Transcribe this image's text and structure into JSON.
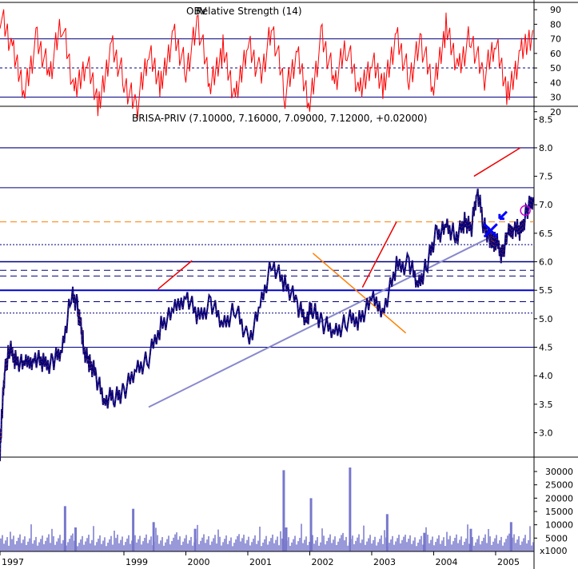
{
  "chart_data": [
    {
      "type": "line",
      "title": "Relative Strength (14)",
      "overlay_title": "OBV",
      "yticks": [
        20,
        30,
        40,
        50,
        60,
        70,
        80,
        90
      ],
      "ylim": [
        10,
        95
      ],
      "reference_lines": {
        "upper": 70,
        "middle": 50,
        "lower": 30
      },
      "series": [
        {
          "color": "#ff0000",
          "x": [
            1997.0,
            1997.2,
            1997.4,
            1997.6,
            1997.8,
            1998.0,
            1998.2,
            1998.4,
            1998.6,
            1998.8,
            1999.0,
            1999.2,
            1999.4,
            1999.6,
            1999.8,
            2000.0,
            2000.2,
            2000.4,
            2000.6,
            2000.8,
            2001.0,
            2001.2,
            2001.4,
            2001.6,
            2001.8,
            2002.0,
            2002.2,
            2002.4,
            2002.6,
            2002.8,
            2003.0,
            2003.2,
            2003.4,
            2003.6,
            2003.8,
            2004.0,
            2004.2,
            2004.4,
            2004.6,
            2004.8,
            2005.0,
            2005.2,
            2005.4,
            2005.6
          ],
          "values": [
            88,
            62,
            35,
            70,
            45,
            82,
            30,
            55,
            25,
            68,
            42,
            22,
            60,
            38,
            75,
            48,
            80,
            35,
            62,
            28,
            70,
            45,
            78,
            33,
            58,
            26,
            72,
            40,
            65,
            30,
            55,
            38,
            74,
            44,
            68,
            35,
            78,
            50,
            72,
            42,
            66,
            30,
            60,
            76
          ]
        }
      ]
    },
    {
      "type": "line",
      "title": "BRISA-PRIV (7.10000, 7.16000, 7.09000, 7.12000, +0.02000)",
      "xlabel": "",
      "ylabel": "",
      "x_ticks": [
        "1997",
        "1999",
        "2000",
        "2001",
        "2002",
        "2003",
        "2004",
        "2005"
      ],
      "x_tick_values": [
        1997.0,
        1999.0,
        2000.0,
        2001.0,
        2002.0,
        2003.0,
        2004.0,
        2005.0
      ],
      "yticks": [
        3.0,
        3.5,
        4.0,
        4.5,
        5.0,
        5.5,
        6.0,
        6.5,
        7.0,
        7.5,
        8.0,
        8.5
      ],
      "ylim": [
        2.6,
        8.7
      ],
      "xlim": [
        1997.0,
        2005.62
      ],
      "grid": false,
      "series": [
        {
          "name": "BRISA-PRIV",
          "color": "#00007f",
          "x": [
            1997.0,
            1997.03,
            1997.08,
            1997.15,
            1997.25,
            1997.4,
            1997.55,
            1997.7,
            1997.85,
            1998.0,
            1998.15,
            1998.25,
            1998.3,
            1998.35,
            1998.45,
            1998.55,
            1998.7,
            1998.85,
            1999.0,
            1999.2,
            1999.4,
            1999.6,
            1999.8,
            2000.0,
            2000.2,
            2000.4,
            2000.6,
            2000.8,
            2001.0,
            2001.2,
            2001.4,
            2001.6,
            2001.8,
            2001.95,
            2002.05,
            2002.2,
            2002.4,
            2002.6,
            2002.8,
            2003.0,
            2003.2,
            2003.4,
            2003.6,
            2003.75,
            2003.9,
            2004.05,
            2004.2,
            2004.35,
            2004.5,
            2004.6,
            2004.7,
            2004.8,
            2004.9,
            2004.95,
            2005.0,
            2005.1,
            2005.2,
            2005.3,
            2005.4,
            2005.5,
            2005.62
          ],
          "values": [
            2.7,
            3.3,
            4.1,
            4.45,
            4.3,
            4.15,
            4.35,
            4.2,
            4.25,
            4.45,
            5.45,
            5.2,
            4.9,
            4.5,
            4.2,
            4.0,
            3.55,
            3.65,
            3.7,
            4.1,
            4.3,
            4.9,
            5.1,
            5.45,
            5.0,
            5.3,
            4.9,
            5.2,
            4.6,
            5.2,
            6.0,
            5.6,
            5.25,
            5.0,
            5.2,
            4.9,
            4.75,
            4.95,
            5.0,
            5.3,
            5.2,
            5.9,
            6.0,
            5.6,
            6.0,
            6.5,
            6.6,
            6.45,
            6.7,
            6.55,
            7.25,
            6.7,
            6.4,
            6.35,
            6.35,
            6.15,
            6.45,
            6.65,
            6.5,
            6.9,
            7.12
          ]
        }
      ]
    },
    {
      "type": "bar",
      "title": "",
      "yticks": [
        5000,
        10000,
        15000,
        20000,
        25000,
        30000
      ],
      "ylim": [
        0,
        33000
      ],
      "unit_label": "x1000",
      "bar_color": "#7777cc",
      "spikes": [
        {
          "x": 1998.05,
          "value": 17000
        },
        {
          "x": 1998.22,
          "value": 9000
        },
        {
          "x": 1999.15,
          "value": 16000
        },
        {
          "x": 1999.48,
          "value": 11000
        },
        {
          "x": 2000.15,
          "value": 8500
        },
        {
          "x": 2001.58,
          "value": 30500
        },
        {
          "x": 2001.62,
          "value": 9000
        },
        {
          "x": 2002.02,
          "value": 20000
        },
        {
          "x": 2002.65,
          "value": 31500
        },
        {
          "x": 2003.25,
          "value": 14000
        },
        {
          "x": 2003.85,
          "value": 7000
        },
        {
          "x": 2004.6,
          "value": 8500
        },
        {
          "x": 2005.25,
          "value": 11000
        }
      ]
    }
  ]
}
